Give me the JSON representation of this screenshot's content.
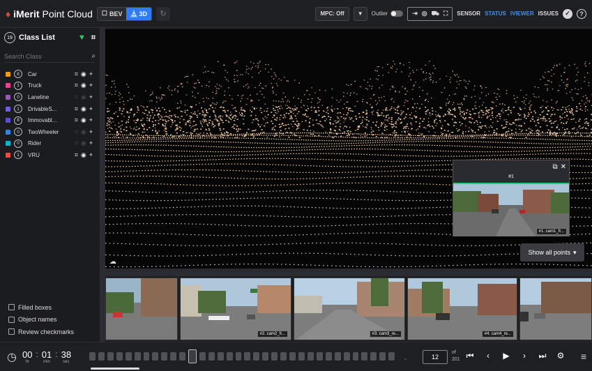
{
  "header": {
    "brand_mark": "♦",
    "brand_name": "iMerit",
    "app_name": "Point Cloud",
    "modes": [
      {
        "label": "BEV",
        "icon": "square-icon",
        "active": false
      },
      {
        "label": "3D",
        "icon": "axes-icon",
        "active": true
      }
    ],
    "mpc_label": "MPC: Off",
    "outlier_label": "Outlier",
    "tabs": [
      {
        "label": "SENSOR",
        "color": "#d8d8d8"
      },
      {
        "label": "STATUS",
        "color": "#4a90e2"
      },
      {
        "label": "IVIEWER",
        "color": "#4a90e2"
      },
      {
        "label": "ISSUES",
        "color": "#d8d8d8"
      }
    ]
  },
  "sidebar": {
    "total_count": "19",
    "title": "Class List",
    "search_placeholder": "Search Class",
    "classes": [
      {
        "name": "Car",
        "count": "8",
        "color": "#f39c12",
        "active": true
      },
      {
        "name": "Truck",
        "count": "1",
        "color": "#e84393",
        "active": true
      },
      {
        "name": "Laneline",
        "count": "0",
        "color": "#9b59b6",
        "active": false
      },
      {
        "name": "DrivableS...",
        "count": "1",
        "color": "#6c5ce7",
        "active": true
      },
      {
        "name": "Immovabl...",
        "count": "8",
        "color": "#5b4cdb",
        "active": true
      },
      {
        "name": "TwoWheeler",
        "count": "0",
        "color": "#2e86de",
        "active": false
      },
      {
        "name": "Rider",
        "count": "0",
        "color": "#00b8d4",
        "active": false
      },
      {
        "name": "VRU",
        "count": "1",
        "color": "#e74c3c",
        "active": true
      }
    ],
    "checkboxes": [
      {
        "label": "Filled boxes"
      },
      {
        "label": "Object names"
      },
      {
        "label": "Review checkmarks"
      }
    ]
  },
  "viewer": {
    "popup_title": "#1",
    "popup_image_label": "#1. cam1_fr...",
    "show_points_label": "Show all points"
  },
  "camera_strip": [
    {
      "label": ""
    },
    {
      "label": "#2. cam2_fr..."
    },
    {
      "label": "#3. cam3_re..."
    },
    {
      "label": "#4. cam4_re..."
    },
    {
      "label": ""
    }
  ],
  "timeline": {
    "hours": "00",
    "minutes": "01",
    "seconds": "38",
    "hr_unit": "hr",
    "min_unit": "min",
    "sec_unit": "sec",
    "current_frame": "12",
    "of_label": "of",
    "total_frames": "201"
  }
}
